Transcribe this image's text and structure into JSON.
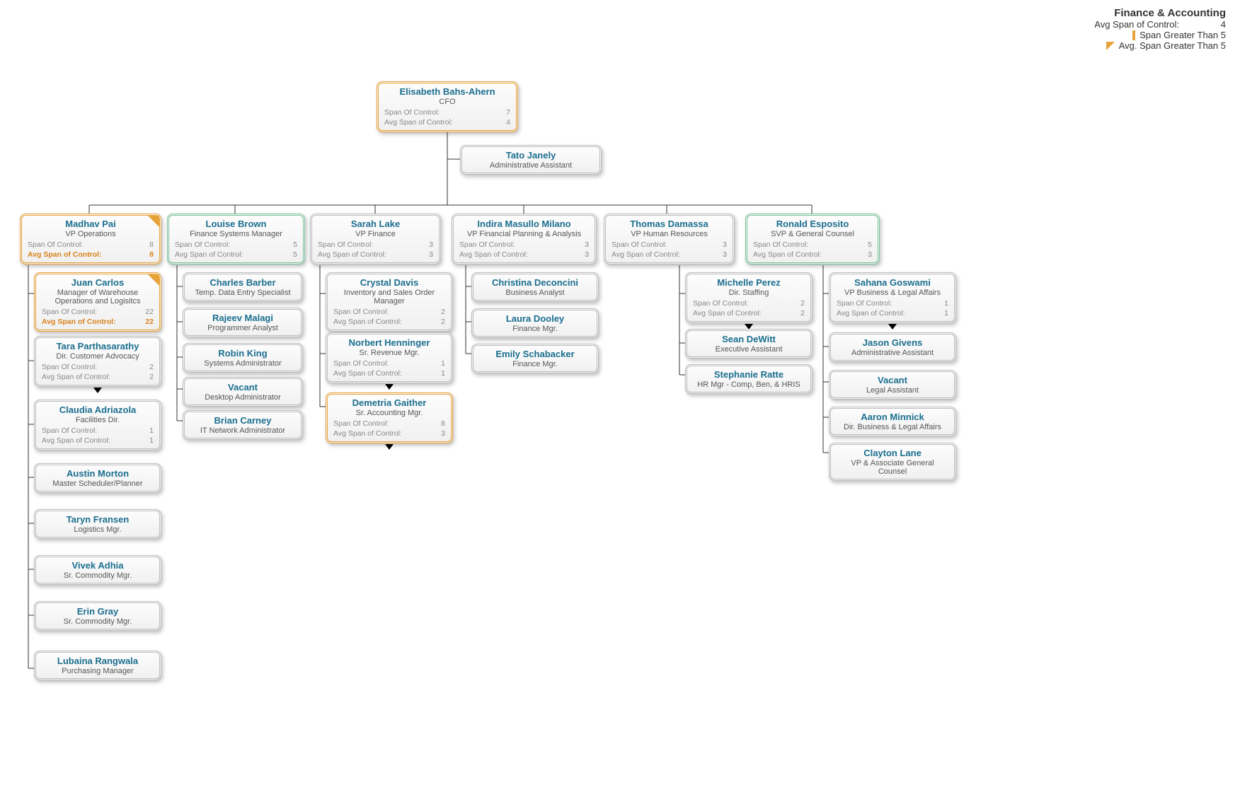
{
  "legend": {
    "title": "Finance & Accounting",
    "avg_label": "Avg Span of Control:",
    "avg_value": "4",
    "span_gt5": "Span Greater Than 5",
    "avg_gt5": "Avg. Span Greater Than 5"
  },
  "labels": {
    "span": "Span Of Control:",
    "avg": "Avg Span of Control:"
  },
  "nodes": {
    "cfo": {
      "name": "Elisabeth Bahs-Ahern",
      "title": "CFO",
      "span": "7",
      "avg": "4"
    },
    "tato": {
      "name": "Tato Janely",
      "title": "Administrative Assistant"
    },
    "madhav": {
      "name": "Madhav Pai",
      "title": "VP Operations",
      "span": "8",
      "avg": "8"
    },
    "louise": {
      "name": "Louise Brown",
      "title": "Finance Systems Manager",
      "span": "5",
      "avg": "5"
    },
    "sarah": {
      "name": "Sarah Lake",
      "title": "VP Finance",
      "span": "3",
      "avg": "3"
    },
    "indira": {
      "name": "Indira Masullo Milano",
      "title": "VP Financial Planning & Analysis",
      "span": "3",
      "avg": "3"
    },
    "thomas": {
      "name": "Thomas Damassa",
      "title": "VP Human Resources",
      "span": "3",
      "avg": "3"
    },
    "ronald": {
      "name": "Ronald Esposito",
      "title": "SVP & General Counsel",
      "span": "5",
      "avg": "3"
    },
    "juan": {
      "name": "Juan Carlos",
      "title": "Manager of Warehouse Operations and Logisitcs",
      "span": "22",
      "avg": "22"
    },
    "tara": {
      "name": "Tara Parthasarathy",
      "title": "Dir. Customer Advocacy",
      "span": "2",
      "avg": "2"
    },
    "claudia": {
      "name": "Claudia Adriazola",
      "title": "Facilities Dir.",
      "span": "1",
      "avg": "1"
    },
    "austin": {
      "name": "Austin Morton",
      "title": "Master Scheduler/Planner"
    },
    "taryn": {
      "name": "Taryn Fransen",
      "title": "Logistics Mgr."
    },
    "vivek": {
      "name": "Vivek Adhia",
      "title": "Sr. Commodity Mgr."
    },
    "erin": {
      "name": "Erin Gray",
      "title": "Sr. Commodity Mgr."
    },
    "lubaina": {
      "name": "Lubaina Rangwala",
      "title": "Purchasing Manager"
    },
    "charles": {
      "name": "Charles Barber",
      "title": "Temp. Data Entry Specialist"
    },
    "rajeev": {
      "name": "Rajeev Malagi",
      "title": "Programmer Analyst"
    },
    "robin": {
      "name": "Robin King",
      "title": "Systems Administrator"
    },
    "vacant1": {
      "name": "Vacant",
      "title": "Desktop Administrator"
    },
    "brian": {
      "name": "Brian Carney",
      "title": "IT Network Administrator"
    },
    "crystal": {
      "name": "Crystal Davis",
      "title": "Inventory and Sales Order Manager",
      "span": "2",
      "avg": "2"
    },
    "norbert": {
      "name": "Norbert Henninger",
      "title": "Sr. Revenue Mgr.",
      "span": "1",
      "avg": "1"
    },
    "demetria": {
      "name": "Demetria Gaither",
      "title": "Sr. Accounting Mgr.",
      "span": "8",
      "avg": "3"
    },
    "christina": {
      "name": "Christina Deconcini",
      "title": "Business Analyst"
    },
    "laura": {
      "name": "Laura Dooley",
      "title": "Finance Mgr."
    },
    "emily": {
      "name": "Emily Schabacker",
      "title": "Finance Mgr."
    },
    "michelle": {
      "name": "Michelle Perez",
      "title": "Dir. Staffing",
      "span": "2",
      "avg": "2"
    },
    "sean": {
      "name": "Sean DeWitt",
      "title": "Executive Assistant"
    },
    "stephanie": {
      "name": "Stephanie Ratte",
      "title": "HR Mgr - Comp, Ben, & HRIS"
    },
    "sahana": {
      "name": "Sahana Goswami",
      "title": "VP Business & Legal Affairs",
      "span": "1",
      "avg": "1"
    },
    "jason": {
      "name": "Jason Givens",
      "title": "Administrative Assistant"
    },
    "vacant2": {
      "name": "Vacant",
      "title": "Legal Assistant"
    },
    "aaron": {
      "name": "Aaron Minnick",
      "title": "Dir. Business & Legal Affairs"
    },
    "clayton": {
      "name": "Clayton Lane",
      "title": "VP & Associate General Counsel"
    }
  }
}
